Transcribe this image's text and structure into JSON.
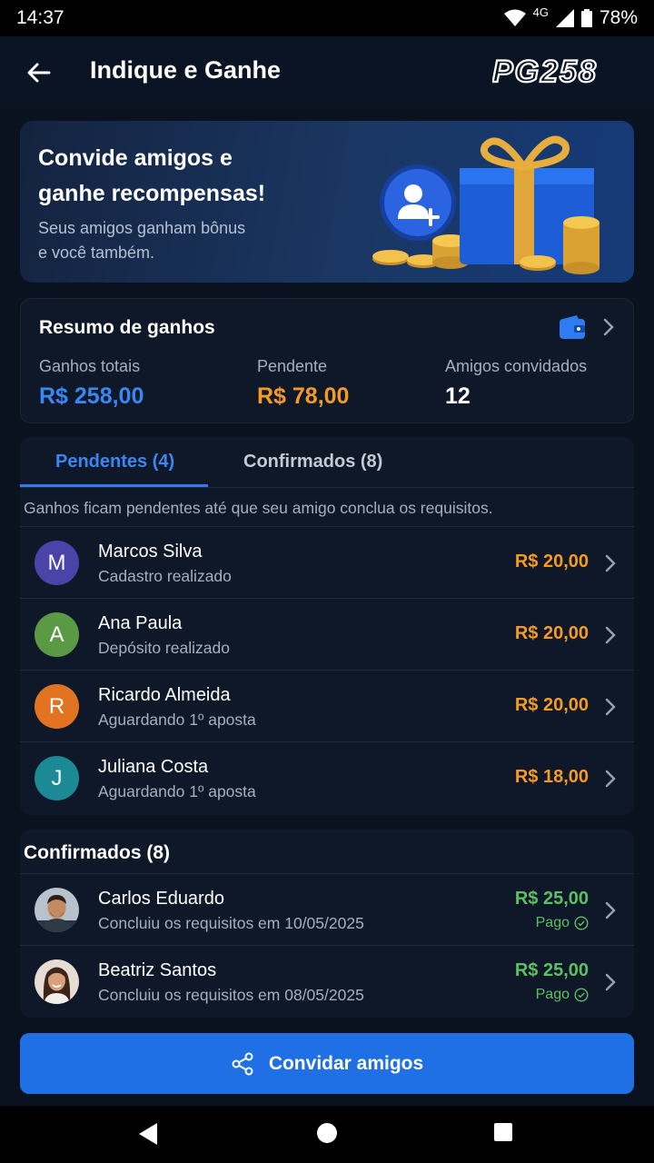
{
  "status_bar": {
    "time": "14:37",
    "network": "4G",
    "battery": "78%"
  },
  "app_bar": {
    "title": "Indique e Ganhe",
    "brand": "PG258"
  },
  "hero": {
    "title": "Convide amigos e\nganhe recompensas!",
    "subtitle": "Seus amigos ganham bônus\ne você também."
  },
  "summary": {
    "title": "Resumo de ganhos",
    "stats": [
      {
        "label": "Ganhos totais",
        "value": "R$ 258,00",
        "color": "#3a86f3"
      },
      {
        "label": "Pendente",
        "value": "R$ 78,00",
        "color": "#f59a23"
      },
      {
        "label": "Amigos convidados",
        "value": "12",
        "color": "#ffffff"
      }
    ]
  },
  "tabs": [
    {
      "label": "Pendentes (4)",
      "active": true
    },
    {
      "label": "Confirmados (8)",
      "active": false
    }
  ],
  "pending_note": "Ganhos ficam pendentes até que seu amigo conclua os requisitos.",
  "pending": [
    {
      "initial": "M",
      "name": "Marcos Silva",
      "status": "Cadastro realizado",
      "amount": "R$ 20,00",
      "avatar_color": "#4a44a8"
    },
    {
      "initial": "A",
      "name": "Ana Paula",
      "status": "Depósito realizado",
      "amount": "R$ 20,00",
      "avatar_color": "#5b9a45"
    },
    {
      "initial": "R",
      "name": "Ricardo Almeida",
      "status": "Aguardando 1º aposta",
      "amount": "R$ 20,00",
      "avatar_color": "#e27320"
    },
    {
      "initial": "J",
      "name": "Juliana Costa",
      "status": "Aguardando 1º aposta",
      "amount": "R$ 18,00",
      "avatar_color": "#1b8a95"
    }
  ],
  "confirmed": {
    "title": "Confirmados (8)",
    "items": [
      {
        "name": "Carlos Eduardo",
        "status": "Concluiu os requisitos em 10/05/2025",
        "amount": "R$ 25,00",
        "paid_label": "Pago"
      },
      {
        "name": "Beatriz Santos",
        "status": "Concluiu os requisitos em 08/05/2025",
        "amount": "R$ 25,00",
        "paid_label": "Pago"
      }
    ]
  },
  "cta": {
    "label": "Convidar amigos"
  },
  "colors": {
    "accent": "#1f6fe5",
    "pending": "#f59a23",
    "confirmed": "#5cc063"
  }
}
